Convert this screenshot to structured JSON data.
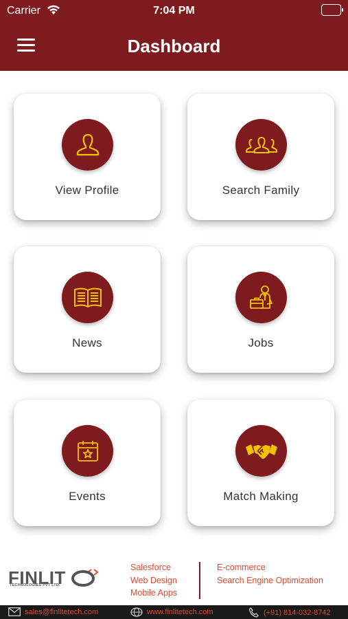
{
  "status_bar": {
    "carrier": "Carrier",
    "time": "7:04 PM"
  },
  "header": {
    "title": "Dashboard",
    "menu_icon": "hamburger-menu-icon"
  },
  "colors": {
    "primary": "#7e1b1f",
    "icon_gold": "#f2c200",
    "accent_orange": "#e0482e"
  },
  "tiles": [
    {
      "label": "View Profile",
      "icon": "user-icon"
    },
    {
      "label": "Search Family",
      "icon": "family-icon"
    },
    {
      "label": "News",
      "icon": "book-icon"
    },
    {
      "label": "Jobs",
      "icon": "businessman-icon"
    },
    {
      "label": "Events",
      "icon": "calendar-star-icon"
    },
    {
      "label": "Match Making",
      "icon": "handshake-icon"
    }
  ],
  "footer": {
    "brand": "FINLIT",
    "brand_sub": "TECHNOLOGIES PVT LTD.",
    "services_left": [
      "Salesforce",
      "Web Design",
      "Mobile Apps"
    ],
    "services_right": [
      "E-commerce",
      "Search Engine Optimization"
    ],
    "email": "sales@finlitetech.com",
    "website": "www.finlitetech.com",
    "phone": "(+91) 814-032-8742"
  }
}
